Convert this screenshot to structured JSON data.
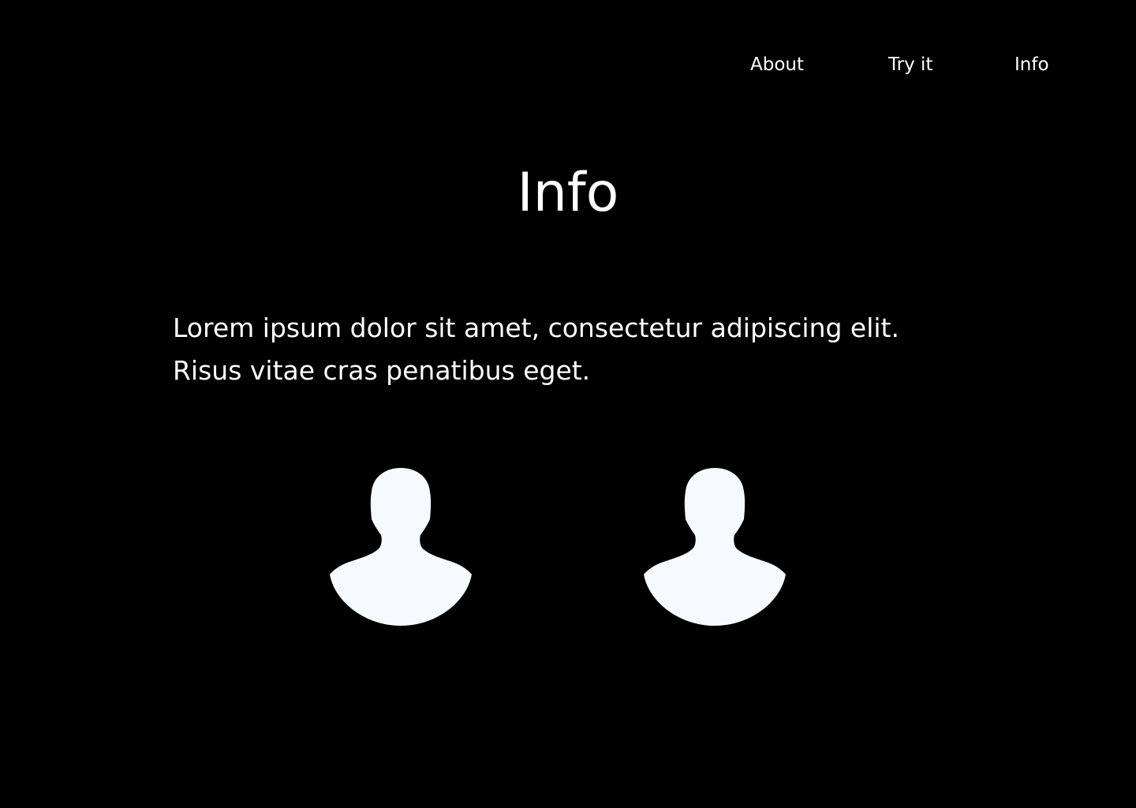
{
  "nav": {
    "items": [
      {
        "label": "About"
      },
      {
        "label": "Try it"
      },
      {
        "label": "Info"
      }
    ]
  },
  "page": {
    "title": "Info",
    "description_lines": [
      "Lorem ipsum dolor sit amet, consectetur adipiscing elit.",
      "Risus vitae cras penatibus eget."
    ]
  },
  "avatars": [
    {
      "icon": "user-silhouette-icon"
    },
    {
      "icon": "user-silhouette-icon"
    }
  ],
  "colors": {
    "background": "#000000",
    "text": "#ffffff",
    "avatar_fill": "#f5faff"
  }
}
